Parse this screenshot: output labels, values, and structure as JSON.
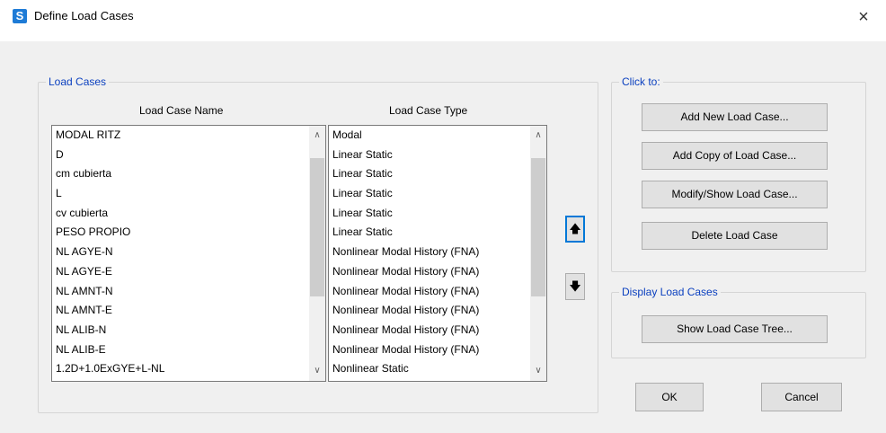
{
  "window": {
    "app_icon": "S",
    "title": "Define Load Cases",
    "close_glyph": "×"
  },
  "load_cases_group": {
    "label": "Load Cases",
    "name_header": "Load Case Name",
    "type_header": "Load Case Type",
    "rows": [
      {
        "name": "MODAL RITZ",
        "type": "Modal"
      },
      {
        "name": "D",
        "type": "Linear Static"
      },
      {
        "name": "cm cubierta",
        "type": "Linear Static"
      },
      {
        "name": "L",
        "type": "Linear Static"
      },
      {
        "name": "cv cubierta",
        "type": "Linear Static"
      },
      {
        "name": "PESO PROPIO",
        "type": "Linear Static"
      },
      {
        "name": "NL AGYE-N",
        "type": "Nonlinear Modal History (FNA)"
      },
      {
        "name": "NL AGYE-E",
        "type": "Nonlinear Modal History (FNA)"
      },
      {
        "name": "NL AMNT-N",
        "type": "Nonlinear Modal History (FNA)"
      },
      {
        "name": "NL AMNT-E",
        "type": "Nonlinear Modal History (FNA)"
      },
      {
        "name": "NL ALIB-N",
        "type": "Nonlinear Modal History (FNA)"
      },
      {
        "name": "NL ALIB-E",
        "type": "Nonlinear Modal History (FNA)"
      },
      {
        "name": "1.2D+1.0ExGYE+L-NL",
        "type": "Nonlinear Static"
      }
    ],
    "scroll_up_glyph": "∧",
    "scroll_down_glyph": "∨",
    "move_up_icon": "arrow-up-icon",
    "move_up_glyph": "🡅",
    "move_down_icon": "arrow-down-icon",
    "move_down_glyph": "🡇"
  },
  "click_to_group": {
    "label": "Click to:",
    "add_new": "Add New Load Case...",
    "add_copy": "Add Copy of Load Case...",
    "modify_show": "Modify/Show Load Case...",
    "delete": "Delete Load Case"
  },
  "display_group": {
    "label": "Display Load Cases",
    "show_tree": "Show Load Case Tree..."
  },
  "footer": {
    "ok": "OK",
    "cancel": "Cancel"
  },
  "colors": {
    "group_label": "#0a3fbf",
    "app_icon_bg": "#1e7bd6",
    "focus_border": "#0078d7"
  }
}
